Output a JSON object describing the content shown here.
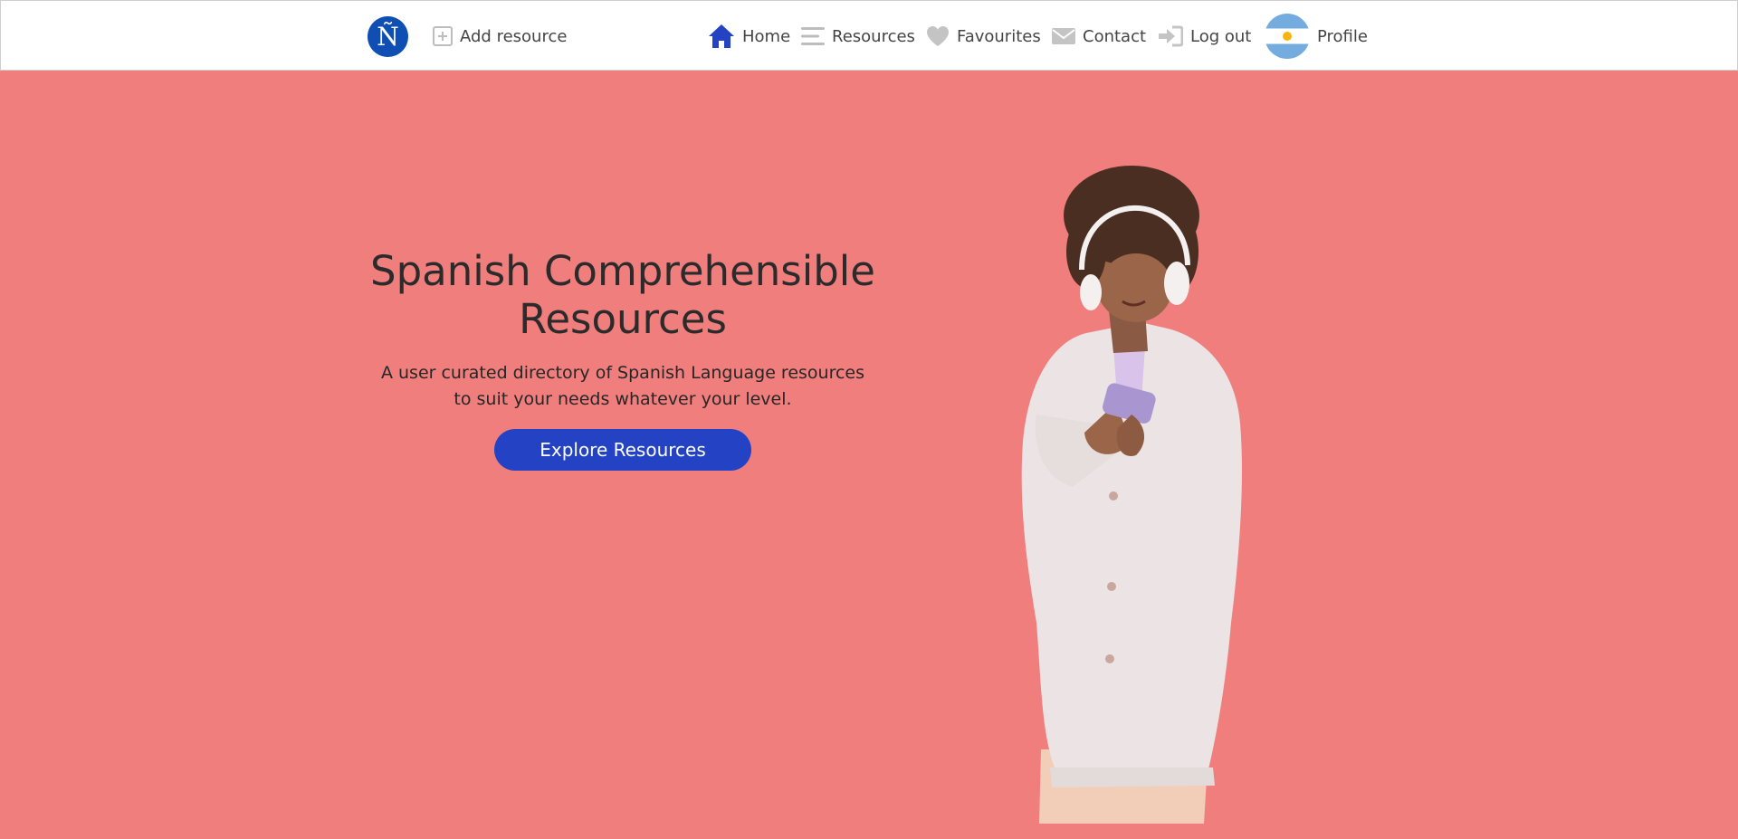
{
  "nav": {
    "logo_text": "Ñ",
    "add_resource": "Add resource",
    "home": "Home",
    "resources": "Resources",
    "favourites": "Favourites",
    "contact": "Contact",
    "log_out": "Log out",
    "profile": "Profile"
  },
  "hero": {
    "title": "Spanish Comprehensible Resources",
    "subtitle": "A user curated directory of Spanish Language resources to suit your needs whatever your level.",
    "button_label": "Explore Resources"
  },
  "colors": {
    "hero_background": "#f07e7d",
    "accent": "#2342c4",
    "logo": "#0f4fb3",
    "nav_text": "#444444"
  },
  "icons": {
    "add_resource": "plus-square-icon",
    "home": "home-icon",
    "resources": "menu-lines-icon",
    "favourites": "heart-icon",
    "contact": "envelope-icon",
    "log_out": "sign-in-arrow-icon",
    "profile": "argentina-flag-avatar"
  }
}
